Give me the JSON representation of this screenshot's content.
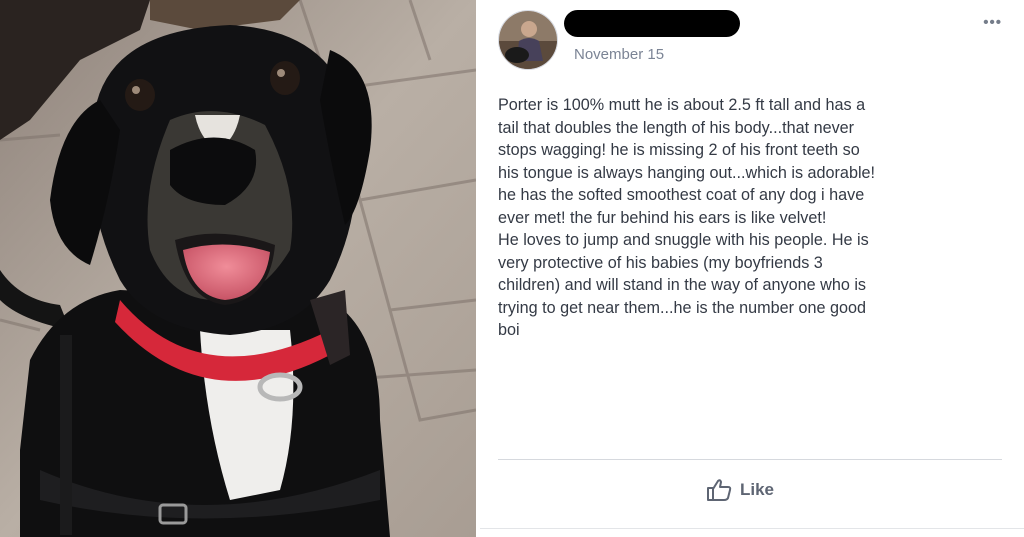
{
  "post": {
    "author": "",
    "date": "November 15",
    "more_icon": "more-options-icon",
    "body": "Porter is 100% mutt he is about 2.5 ft tall and has a\ntail that doubles the length of his body...that never\nstops wagging! he is missing 2 of his front teeth so\nhis tongue is always hanging out...which is adorable!\nhe has the softed smoothest coat of any dog i have\never met! the fur behind his ears is like velvet!\nHe loves to jump and snuggle with his people. He is\nvery protective of his babies (my boyfriends 3\nchildren) and will stand in the way of anyone who is\ntrying to get near them...he is the number one good\nboi",
    "like_label": "Like",
    "like_icon": "thumbs-up-icon"
  },
  "colors": {
    "text": "#343a45",
    "date": "#7b8495",
    "like": "#5e6573",
    "collar": "#d6283a"
  }
}
